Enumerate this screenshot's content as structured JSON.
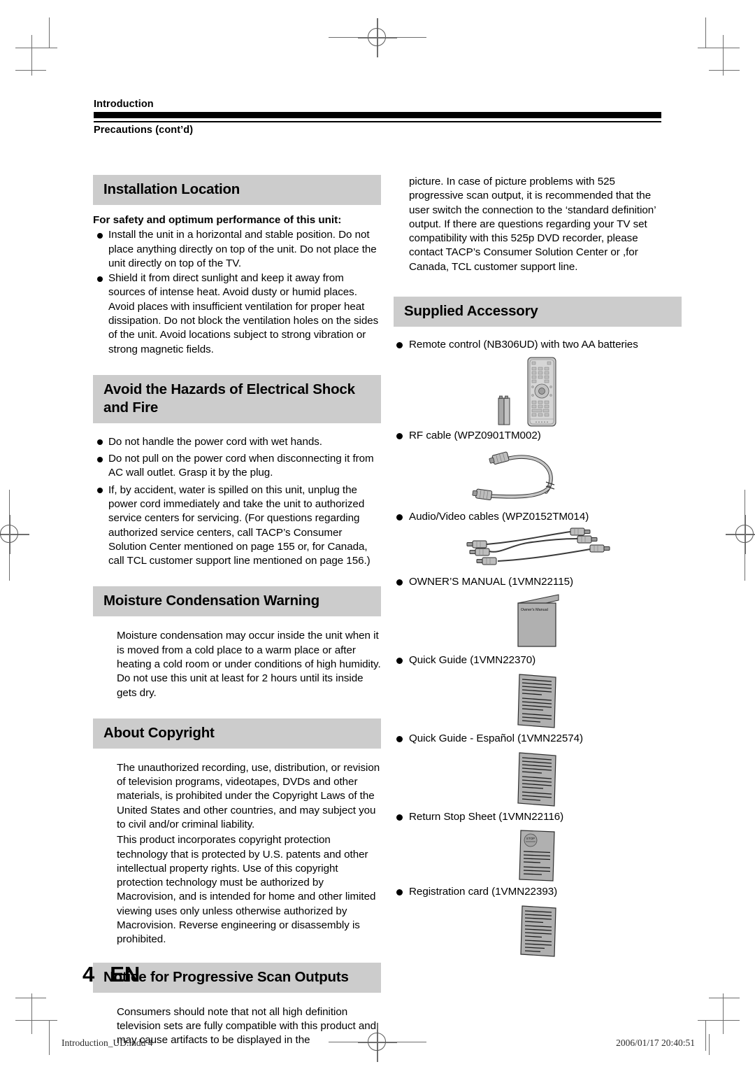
{
  "header": {
    "section_label": "Introduction",
    "page_subtitle": "Precautions (cont’d)"
  },
  "left_column": {
    "sections": [
      {
        "heading": "Installation Location",
        "lead": "For safety and optimum performance of this unit:",
        "bullets": [
          "Install the unit in a horizontal and stable position. Do not place anything directly on top of the unit. Do not place the unit directly on top of the TV.",
          "Shield it from direct sunlight and keep it away from sources of intense heat. Avoid dusty or humid places. Avoid places with insufficient ventilation for proper heat dissipation. Do not block the ventilation holes on the sides of the unit.  Avoid locations subject to strong vibration or strong magnetic fields."
        ]
      },
      {
        "heading": "Avoid the Hazards of Electrical Shock and Fire",
        "bullets": [
          "Do not handle the power cord with wet hands.",
          "Do not pull on the power cord when disconnecting it from AC wall outlet. Grasp it by the plug.",
          "If, by accident, water is spilled on this unit, unplug the power cord immediately and take the unit to authorized service centers for servicing. (For questions regarding authorized service centers, call TACP’s Consumer Solution Center mentioned on page 155 or, for Canada, call TCL customer support line mentioned on page 156.)"
        ]
      },
      {
        "heading": "Moisture Condensation Warning",
        "paragraphs": [
          "Moisture condensation may occur inside the unit when it is moved from a cold place to a warm place or after heating a cold room or under conditions of high humidity. Do not use this unit at least for 2 hours until its inside gets dry."
        ]
      },
      {
        "heading": "About Copyright",
        "paragraphs": [
          "The unauthorized recording, use, distribution, or revision of television programs, videotapes, DVDs and other materials, is prohibited under the Copyright Laws of the United States and other countries, and may subject you to civil and/or criminal liability.",
          "This product incorporates copyright protection technology that is protected by U.S. patents and other intellectual property rights. Use of this copyright protection technology must be authorized by Macrovision, and is intended for home and other limited viewing uses only unless otherwise authorized by Macrovision. Reverse engineering or disassembly is prohibited."
        ]
      },
      {
        "heading": "Notice for Progressive Scan Outputs",
        "paragraphs": [
          "Consumers should note that not all high definition television sets are fully compatible with this product and may cause artifacts to be displayed in the"
        ]
      }
    ]
  },
  "right_column": {
    "continuation_paragraph": "picture.  In case of picture problems with 525 progressive scan output, it is recommended that the user switch the connection to the ‘standard definition’ output. If there are questions regarding your TV set compatibility with this 525p DVD recorder, please contact TACP’s Consumer Solution Center or ,for Canada, TCL customer support line.",
    "accessory_section": {
      "heading": "Supplied Accessory",
      "items": [
        {
          "label": "Remote control (NB306UD) with two AA batteries",
          "figure": "remote-control-and-batteries"
        },
        {
          "label": "RF cable (WPZ0901TM002)",
          "figure": "rf-cable"
        },
        {
          "label": "Audio/Video cables (WPZ0152TM014)",
          "figure": "av-cables"
        },
        {
          "label": "OWNER’S MANUAL (1VMN22115)",
          "figure": "owners-manual-booklet",
          "figure_caption": "Owner's Manual"
        },
        {
          "label": "Quick Guide (1VMN22370)",
          "figure": "quick-guide-sheet"
        },
        {
          "label": "Quick Guide - Español (1VMN22574)",
          "figure": "quick-guide-spanish-sheet"
        },
        {
          "label": "Return Stop Sheet (1VMN22116)",
          "figure": "return-stop-sheet",
          "figure_caption": "STOP"
        },
        {
          "label": "Registration card (1VMN22393)",
          "figure": "registration-card-sheet"
        }
      ]
    }
  },
  "folio": {
    "page_number": "4",
    "language_code": "EN"
  },
  "footer": {
    "filename": "Introduction_UD.indd   4",
    "timestamp": "2006/01/17   20:40:51"
  },
  "colors": {
    "heading_bar": "#cccccc",
    "rule": "#000000",
    "artwork_fill": "#b3b3b3",
    "crop_mark": "#6e6e6e"
  }
}
